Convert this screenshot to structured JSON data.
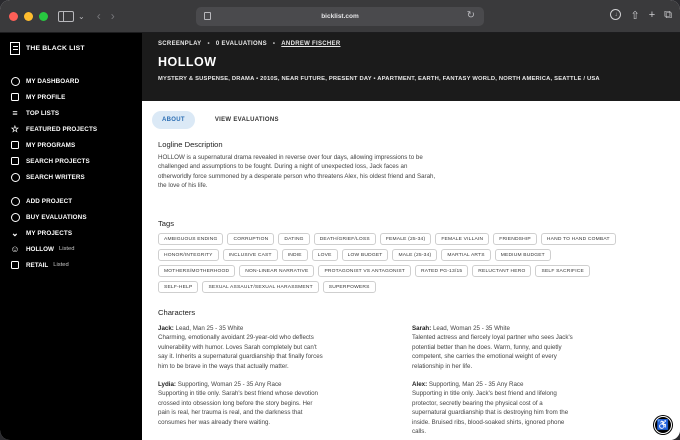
{
  "browser": {
    "url": "bicklist.com"
  },
  "sidebar": {
    "brand": "THE BLACK LIST",
    "items": [
      {
        "label": "MY DASHBOARD",
        "icon": "dashboard-icon"
      },
      {
        "label": "MY PROFILE",
        "icon": "profile-icon"
      },
      {
        "label": "TOP LISTS",
        "icon": "list-icon"
      },
      {
        "label": "FEATURED PROJECTS",
        "icon": "star-icon"
      },
      {
        "label": "MY PROGRAMS",
        "icon": "calendar-icon"
      },
      {
        "label": "SEARCH PROJECTS",
        "icon": "search-projects-icon"
      },
      {
        "label": "SEARCH WRITERS",
        "icon": "search-writers-icon"
      }
    ],
    "actions": [
      {
        "label": "ADD PROJECT",
        "icon": "plus-circle-icon"
      },
      {
        "label": "BUY EVALUATIONS",
        "icon": "cart-icon"
      },
      {
        "label": "MY PROJECTS",
        "icon": "chevron-down-icon"
      }
    ],
    "projects": [
      {
        "name": "HOLLOW",
        "status": "Listed"
      },
      {
        "name": "RETAIL",
        "status": "Listed"
      }
    ]
  },
  "header": {
    "type": "SCREENPLAY",
    "evaluations": "0 EVALUATIONS",
    "author": "ANDREW FISCHER",
    "title": "HOLLOW",
    "genres": "MYSTERY & SUSPENSE, DRAMA  •  2010S, NEAR FUTURE, PRESENT DAY  •  APARTMENT, EARTH, FANTASY WORLD, NORTH AMERICA, SEATTLE / USA"
  },
  "tabs": [
    {
      "label": "ABOUT",
      "active": true
    },
    {
      "label": "VIEW EVALUATIONS",
      "active": false
    }
  ],
  "logline": {
    "heading": "Logline Description",
    "text": "HOLLOW is a supernatural drama revealed in reverse over four days, allowing impressions to be challenged and assumptions to be fought. During a night of unexpected loss, Jack faces an otherworldly force summoned by a desperate person who threatens Alex, his oldest friend and Sarah, the love of his life."
  },
  "tags": {
    "heading": "Tags",
    "items": [
      "AMBIGUOUS ENDING",
      "CORRUPTION",
      "DATING",
      "DEATH/GRIEF/LOSS",
      "FEMALE (25-34)",
      "FEMALE VILLAIN",
      "FRIENDSHIP",
      "HAND TO HAND COMBAT",
      "HONOR/INTEGRITY",
      "INCLUSIVE CAST",
      "INDIE",
      "LOVE",
      "LOW BUDGET",
      "MALE (25-34)",
      "MARTIAL ARTS",
      "MEDIUM BUDGET",
      "MOTHERS/MOTHERHOOD",
      "NON-LINEAR NARRATIVE",
      "PROTAGONIST VS ANTAGONIST",
      "RATED PG-13/15",
      "RELUCTANT HERO",
      "SELF SACRIFICE",
      "SELF-HELP",
      "SEXUAL ASSAULT/SEXUAL HARASSMENT",
      "SUPERPOWERS"
    ]
  },
  "characters": {
    "heading": "Characters",
    "items": [
      {
        "name": "Jack:",
        "role": " Lead, Man 25 - 35 White",
        "desc": "Charming, emotionally avoidant 29-year-old who deflects vulnerability with humor. Loves Sarah completely but can't say it. Inherits a supernatural guardianship that finally forces him to be brave in the ways that actually matter."
      },
      {
        "name": "Sarah:",
        "role": " Lead, Woman 25 - 35 White",
        "desc": "Talented actress and fiercely loyal partner who sees Jack's potential better than he does. Warm, funny, and quietly competent, she carries the emotional weight of every relationship in her life."
      },
      {
        "name": "Lydia:",
        "role": " Supporting, Woman 25 - 35 Any Race",
        "desc": "Supporting in title only. Sarah's best friend whose devotion crossed into obsession long before the story begins. Her pain is real, her trauma is real, and the darkness that consumes her was already there waiting."
      },
      {
        "name": "Alex:",
        "role": " Supporting, Man 25 - 35 Any Race",
        "desc": "Supporting in title only. Jack's best friend and lifelong protector, secretly bearing the physical cost of a supernatural guardianship that is destroying him from the inside. Bruised ribs, blood-soaked shirts, ignored phone calls."
      }
    ]
  }
}
